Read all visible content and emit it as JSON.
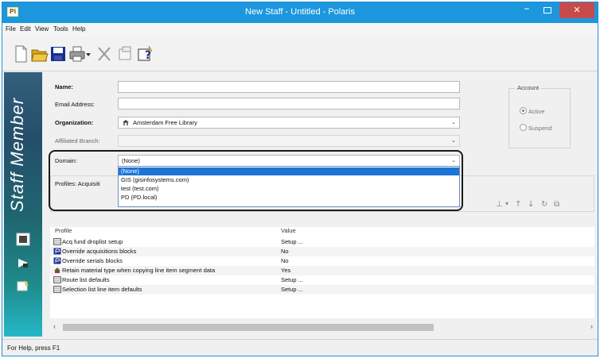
{
  "window": {
    "title": "New Staff - Untitled - Polaris",
    "app_icon": "Pi"
  },
  "menu": [
    "File",
    "Edit",
    "View",
    "Tools",
    "Help"
  ],
  "sidebar": {
    "title": "Staff Member"
  },
  "form": {
    "name_label": "Name:",
    "email_label": "Email Address:",
    "organization_label": "Organization:",
    "organization_value": "Amsterdam Free Library",
    "branch_label": "Affiliated Branch:",
    "domain_label": "Domain:",
    "domain_value": "(None)",
    "profiles_label": "Profiles: Acquisiti"
  },
  "account": {
    "legend": "Account",
    "active": "Active",
    "suspend": "Suspend"
  },
  "domain_options": [
    "(None)",
    "GIS (gisinfosystems.com)",
    "test (test.com)",
    "PD (PD.local)"
  ],
  "profiles_table": {
    "headers": [
      "Profile",
      "Value"
    ],
    "rows": [
      {
        "profile": "Acq fund droplist setup",
        "value": "Setup ..."
      },
      {
        "profile": "Override acquisitions blocks",
        "value": "No"
      },
      {
        "profile": "Override serials blocks",
        "value": "No"
      },
      {
        "profile": "Retain material type when copying line item segment data",
        "value": "Yes"
      },
      {
        "profile": "Route list defaults",
        "value": "Setup ..."
      },
      {
        "profile": "Selection list line item defaults",
        "value": "Setup ..."
      }
    ]
  },
  "status": "For Help, press F1"
}
